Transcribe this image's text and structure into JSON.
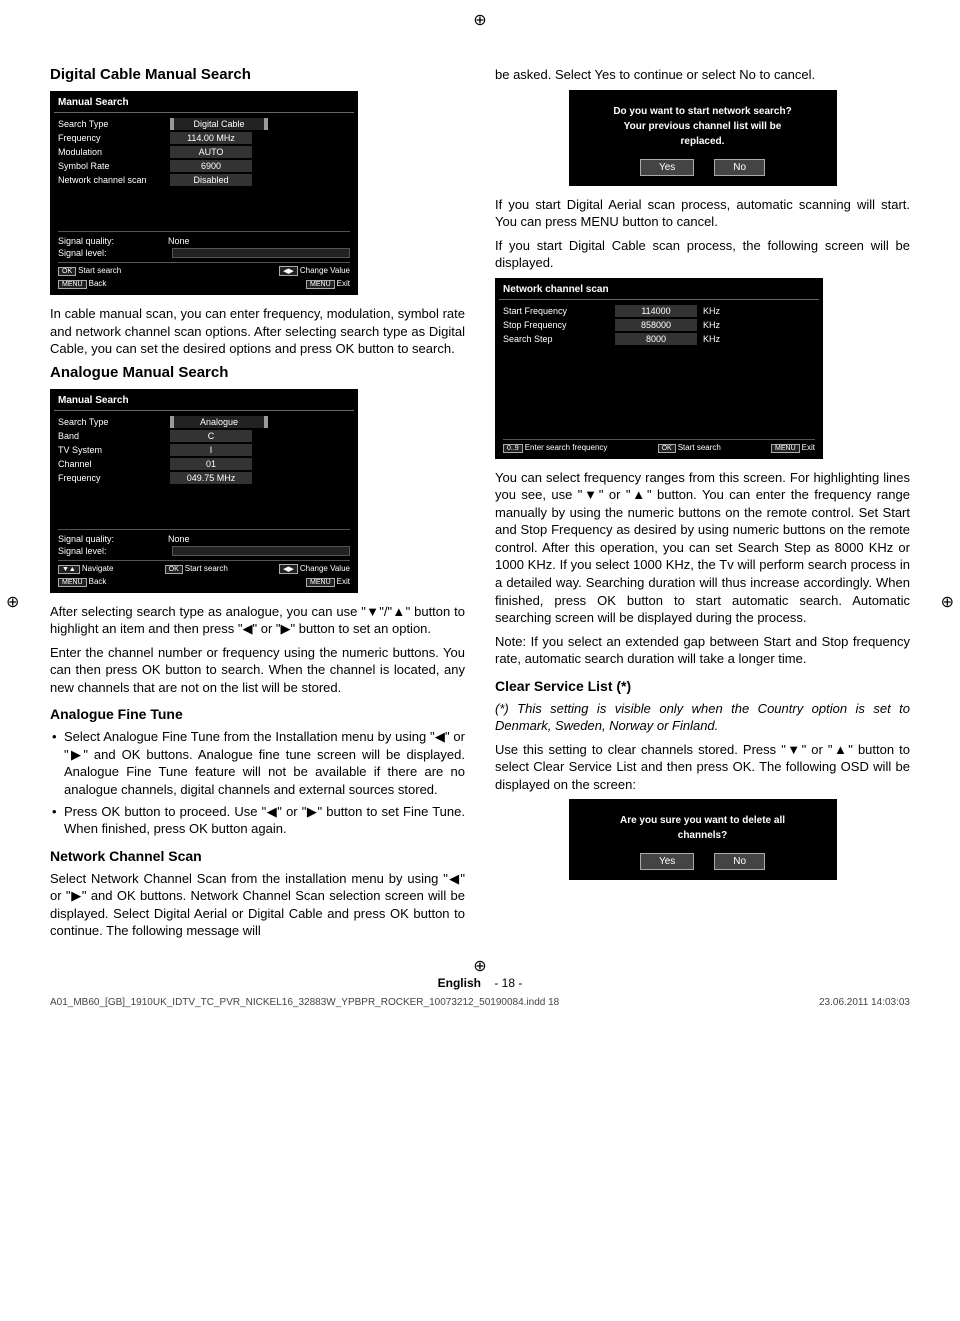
{
  "headings": {
    "h1": "Digital Cable Manual Search",
    "h2": "Analogue Manual Search",
    "h3": "Analogue Fine Tune",
    "h4": "Network Channel Scan",
    "h5": "Clear Service List (*)"
  },
  "paras": {
    "p1a": "In cable manual scan, you can enter frequency, modulation, symbol rate and network channel scan options. After selecting search type as Digital Cable, you can set the desired options and press OK button to search.",
    "p2a": "After selecting search type as analogue, you can use \"▼\"/\"▲\" button to highlight an item and then press \"◀\" or \"▶\" button to set an option.",
    "p2b": "Enter the channel number or frequency using the numeric buttons. You can then press OK button to search. When the channel is located, any new channels that are not on the list will be stored.",
    "b1": "Select Analogue Fine Tune from the Installation menu by using \"◀\" or \"▶\" and OK buttons. Analogue fine tune screen will be displayed. Analogue Fine Tune feature will not be available if there are no analogue channels, digital channels and external sources stored.",
    "b2": "Press OK button to proceed. Use \"◀\" or \"▶\" button to set Fine Tune. When finished, press OK button again.",
    "p4a": "Select Network Channel Scan from the installation menu by using \"◀\" or \"▶\" and OK buttons. Network Channel Scan selection screen will be displayed. Select Digital Aerial or Digital Cable and press OK button to continue. The following message will",
    "r1": "be asked. Select Yes to continue or select No to cancel.",
    "r2": "If you start Digital Aerial scan process, automatic scanning will start. You can press MENU button to cancel.",
    "r3": "If you start Digital Cable scan process, the following screen will be displayed.",
    "r4": "You can select frequency ranges from this screen. For highlighting lines you see, use \"▼\" or \"▲\" button. You can enter the frequency range manually by using the numeric buttons on the remote control. Set Start and Stop Frequency as desired by using numeric buttons on the remote control. After this operation, you can set Search Step as 8000 KHz or 1000 KHz. If you select 1000 KHz, the Tv will perform search process in a detailed way. Searching duration will thus increase accordingly. When finished, press OK button to start automatic search. Automatic searching screen will be displayed during the process.",
    "r5": "Note: If you select an extended gap between Start and Stop frequency rate, automatic search duration will take a longer time.",
    "r6": "(*) This setting is visible only when the Country option is set to Denmark, Sweden, Norway or Finland.",
    "r7": "Use this setting to clear channels stored. Press \"▼\" or \"▲\" button to select Clear Service List and then press OK. The following OSD will be displayed on the screen:"
  },
  "osd1": {
    "title": "Manual Search",
    "rows": {
      "search_type": {
        "label": "Search Type",
        "value": "Digital Cable"
      },
      "frequency": {
        "label": "Frequency",
        "value": "114.00 MHz"
      },
      "modulation": {
        "label": "Modulation",
        "value": "AUTO"
      },
      "symbol_rate": {
        "label": "Symbol Rate",
        "value": "6900"
      },
      "network": {
        "label": "Network channel scan",
        "value": "Disabled"
      }
    },
    "sig_quality": "Signal quality:",
    "sig_quality_val": "None",
    "sig_level": "Signal level:",
    "foot": {
      "a": "OK Start search",
      "b": "◀▶ Change Value",
      "c": "MENU Back",
      "d": "MENU Exit"
    }
  },
  "osd2": {
    "title": "Manual Search",
    "rows": {
      "search_type": {
        "label": "Search Type",
        "value": "Analogue"
      },
      "band": {
        "label": "Band",
        "value": "C"
      },
      "tv_system": {
        "label": "TV System",
        "value": "I"
      },
      "channel": {
        "label": "Channel",
        "value": "01"
      },
      "frequency": {
        "label": "Frequency",
        "value": "049.75 MHz"
      }
    },
    "sig_quality": "Signal quality:",
    "sig_quality_val": "None",
    "sig_level": "Signal level:",
    "foot": {
      "a": "▼▲ Navigate",
      "b": "OK Start search",
      "c": "◀▶ Change Value",
      "d": "MENU Back",
      "e": "MENU Exit"
    }
  },
  "dialog1": {
    "line1": "Do you want to start network search?",
    "line2": "Your previous channel list will be",
    "line3": "replaced.",
    "yes": "Yes",
    "no": "No"
  },
  "osd3": {
    "title": "Network channel scan",
    "rows": {
      "start": {
        "label": "Start Frequency",
        "value": "114000",
        "unit": "KHz"
      },
      "stop": {
        "label": "Stop Frequency",
        "value": "858000",
        "unit": "KHz"
      },
      "step": {
        "label": "Search Step",
        "value": "8000",
        "unit": "KHz"
      }
    },
    "foot": {
      "a": "0..9 Enter search frequency",
      "b": "OK Start search",
      "c": "MENU Exit"
    }
  },
  "dialog2": {
    "line1": "Are you sure you want to delete all",
    "line2": "channels?",
    "yes": "Yes",
    "no": "No"
  },
  "footer": {
    "lang": "English",
    "dash": "-",
    "page": "18"
  },
  "meta": {
    "file": "A01_MB60_[GB]_1910UK_IDTV_TC_PVR_NICKEL16_32883W_YPBPR_ROCKER_10073212_50190084.indd   18",
    "date": "23.06.2011   14:03:03"
  }
}
